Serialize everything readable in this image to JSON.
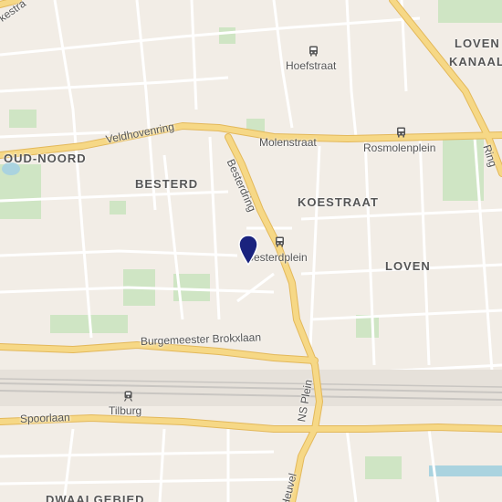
{
  "map": {
    "districts": [
      {
        "key": "oud_noord",
        "text": "OUD-NOORD"
      },
      {
        "key": "besterd",
        "text": "BESTERD"
      },
      {
        "key": "koestraat",
        "text": "KOESTRAAT"
      },
      {
        "key": "loven",
        "text": "LOVEN"
      },
      {
        "key": "loven_kanaal_1",
        "text": "LOVEN"
      },
      {
        "key": "loven_kanaal_2",
        "text": "KANAAL"
      },
      {
        "key": "dwaalgebied",
        "text": "DWAALGEBIED"
      }
    ],
    "streets": {
      "veldhovenring": "Veldhovenring",
      "molenstraat": "Molenstraat",
      "besterdring": "Besterdring",
      "burgemeester": "Burgemeester Brokxlaan",
      "spoorlaan": "Spoorlaan",
      "nsplein": "NS Plein",
      "heuvelring": "Heuvel",
      "ringbaan": "Ring",
      "kestraat": "kestra"
    },
    "stops": {
      "hoefstraat": "Hoefstraat",
      "rosmolenplein": "Rosmolenplein",
      "besterdplein": "Besterdplein",
      "tilburg": "Tilburg"
    },
    "colors": {
      "background": "#f2ede6",
      "major_road": "#f6d886",
      "major_road_edge": "#e3b85a",
      "minor_road": "#ffffff",
      "park": "#cfe5c4",
      "rail": "#c9c6c2",
      "water": "#aad3df",
      "pin": "#1a237e"
    },
    "marker": {
      "name": "location-pin-icon"
    }
  }
}
